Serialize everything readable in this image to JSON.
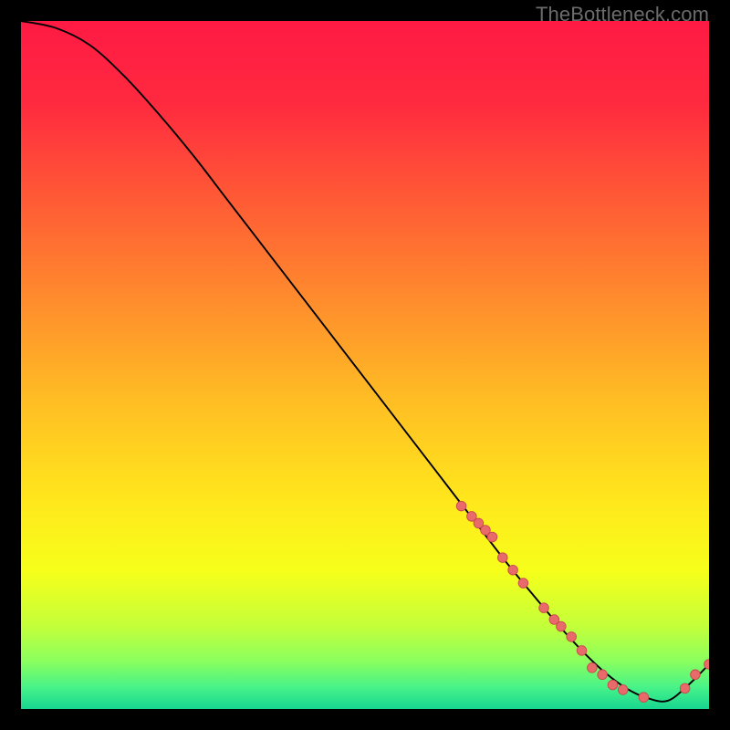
{
  "attribution": "TheBottleneck.com",
  "gradient": {
    "stops": [
      {
        "offset": 0.0,
        "color": "#ff1a44"
      },
      {
        "offset": 0.12,
        "color": "#ff2a3f"
      },
      {
        "offset": 0.25,
        "color": "#ff5736"
      },
      {
        "offset": 0.4,
        "color": "#ff8a2d"
      },
      {
        "offset": 0.55,
        "color": "#ffbd24"
      },
      {
        "offset": 0.7,
        "color": "#ffe81c"
      },
      {
        "offset": 0.8,
        "color": "#f6ff1a"
      },
      {
        "offset": 0.88,
        "color": "#c3ff3a"
      },
      {
        "offset": 0.93,
        "color": "#8bff5e"
      },
      {
        "offset": 0.97,
        "color": "#45f28a"
      },
      {
        "offset": 1.0,
        "color": "#17d58f"
      }
    ]
  },
  "chart_data": {
    "type": "line",
    "title": "",
    "xlabel": "",
    "ylabel": "",
    "xlim": [
      0,
      100
    ],
    "ylim": [
      0,
      100
    ],
    "series": [
      {
        "name": "curve",
        "x": [
          0,
          5,
          10,
          15,
          20,
          25,
          30,
          35,
          40,
          45,
          50,
          55,
          60,
          65,
          70,
          73,
          76,
          79,
          82,
          85,
          88,
          91,
          94,
          97,
          100
        ],
        "values": [
          100,
          99,
          96.5,
          92,
          86.5,
          80.5,
          74,
          67.5,
          61,
          54.5,
          48,
          41.5,
          35,
          28.5,
          22,
          18.3,
          14.7,
          11.2,
          8.0,
          5.2,
          3.0,
          1.6,
          1.2,
          3.5,
          6.5
        ]
      }
    ],
    "markers_x": [
      64,
      65.5,
      66.5,
      67.5,
      68.5,
      70,
      71.5,
      73,
      76,
      77.5,
      78.5,
      80,
      81.5,
      83,
      84.5,
      86,
      87.5,
      90.5,
      96.5,
      98,
      100
    ],
    "markers_values": [
      29.5,
      28,
      27,
      26,
      25,
      22,
      20.2,
      18.3,
      14.7,
      13,
      12,
      10.5,
      8.5,
      6,
      5,
      3.5,
      2.8,
      1.7,
      3,
      5,
      6.5
    ],
    "marker_color": "#e86a6a",
    "marker_stroke": "#c94a4a",
    "marker_radius": 5.3
  }
}
